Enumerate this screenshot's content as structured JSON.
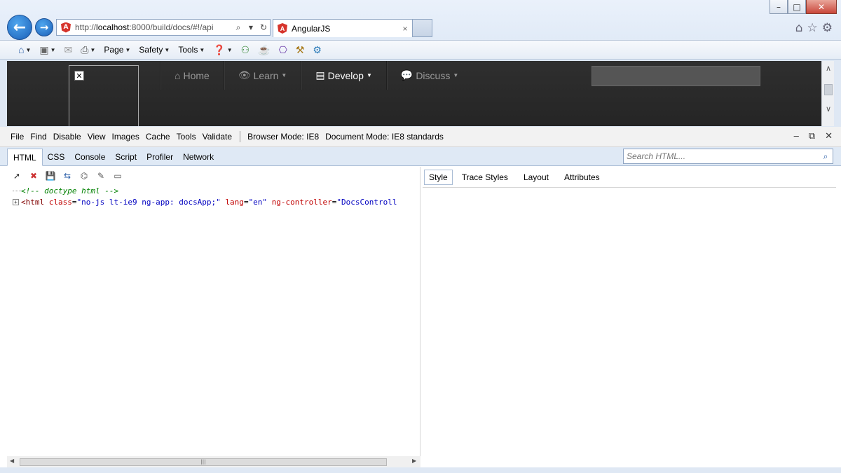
{
  "window": {
    "controls": {
      "minimize": "–",
      "maximize": "□",
      "close": "✕"
    }
  },
  "address_bar": {
    "url_prefix": "http://",
    "url_host": "localhost",
    "url_rest": ":8000/build/docs/#!/api",
    "logo_letter": "A"
  },
  "tab": {
    "title": "AngularJS",
    "close": "×"
  },
  "command_bar": {
    "items": [
      {
        "label": "Page"
      },
      {
        "label": "Safety"
      },
      {
        "label": "Tools"
      }
    ]
  },
  "page": {
    "broken_image": "✕",
    "nav": [
      {
        "label": "Home",
        "icon": "home-icon",
        "glyph": "⌂",
        "active": false,
        "dropdown": false
      },
      {
        "label": "Learn",
        "icon": "eye-icon",
        "glyph": "👁",
        "active": false,
        "dropdown": true
      },
      {
        "label": "Develop",
        "icon": "book-icon",
        "glyph": "▤",
        "active": true,
        "dropdown": true
      },
      {
        "label": "Discuss",
        "icon": "comment-icon",
        "glyph": "💬",
        "active": false,
        "dropdown": true
      }
    ]
  },
  "devtools": {
    "menu": [
      "File",
      "Find",
      "Disable",
      "View",
      "Images",
      "Cache",
      "Tools",
      "Validate"
    ],
    "browser_mode_label": "Browser Mode:",
    "browser_mode_value": "IE8",
    "document_mode_label": "Document Mode:",
    "document_mode_value": "IE8 standards",
    "tabs": [
      "HTML",
      "CSS",
      "Console",
      "Script",
      "Profiler",
      "Network"
    ],
    "active_tab": "HTML",
    "search_placeholder": "Search HTML...",
    "tree": {
      "comment": "<!-- doctype html -->",
      "tag_open": "<html",
      "attrs": [
        {
          "name": "class",
          "value": "\"no-js lt-ie9 ng-app: docsApp;\""
        },
        {
          "name": "lang",
          "value": "\"en\""
        },
        {
          "name": "ng-controller",
          "value": "\"DocsControll"
        }
      ]
    },
    "right_tabs": [
      "Style",
      "Trace Styles",
      "Layout",
      "Attributes"
    ],
    "active_right_tab": "Style"
  }
}
